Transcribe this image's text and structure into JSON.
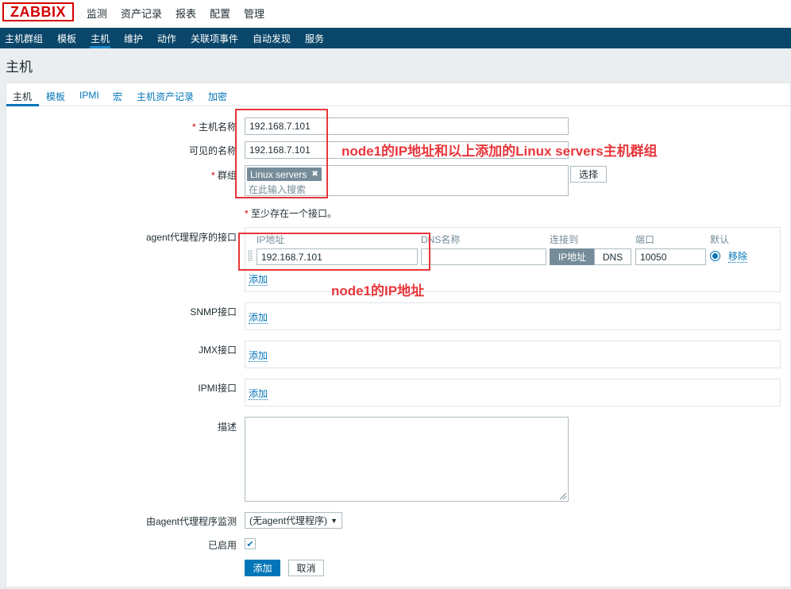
{
  "logo": "ZABBIX",
  "top_menu": [
    "监测",
    "资产记录",
    "报表",
    "配置",
    "管理"
  ],
  "sub_menu": [
    "主机群组",
    "模板",
    "主机",
    "维护",
    "动作",
    "关联项事件",
    "自动发现",
    "服务"
  ],
  "page_title": "主机",
  "tabs": [
    "主机",
    "模板",
    "IPMI",
    "宏",
    "主机资产记录",
    "加密"
  ],
  "form": {
    "host_name_label": "主机名称",
    "host_name_value": "192.168.7.101",
    "visible_name_label": "可见的名称",
    "visible_name_value": "192.168.7.101",
    "groups_label": "群组",
    "group_tag": "Linux servers",
    "group_remove": "✖",
    "groups_placeholder": "在此输入搜索",
    "select_button": "选择",
    "interface_note": "至少存在一个接口。",
    "required_mark": "*",
    "agent_iface_label": "agent代理程序的接口",
    "col_ip": "IP地址",
    "col_dns": "DNS名称",
    "col_connect": "连接到",
    "col_port": "端口",
    "col_default": "默认",
    "agent_ip_value": "192.168.7.101",
    "agent_dns_value": "",
    "connect_ip": "IP地址",
    "connect_dns": "DNS",
    "port_value": "10050",
    "remove_link": "移除",
    "add_link": "添加",
    "snmp_label": "SNMP接口",
    "jmx_label": "JMX接口",
    "ipmi_label": "IPMI接口",
    "description_label": "描述",
    "description_value": "",
    "proxy_label": "由agent代理程序监测",
    "proxy_value": "(无agent代理程序)",
    "enabled_label": "已启用",
    "add_button": "添加",
    "cancel_button": "取消"
  },
  "annotations": {
    "top": "node1的IP地址和以上添加的Linux servers主机群组",
    "bottom": "node1的IP地址"
  },
  "colors": {
    "header_bg": "#0a466a",
    "accent": "#0275b8",
    "logo_red": "#d40000",
    "annotation_red": "#e8363b"
  }
}
